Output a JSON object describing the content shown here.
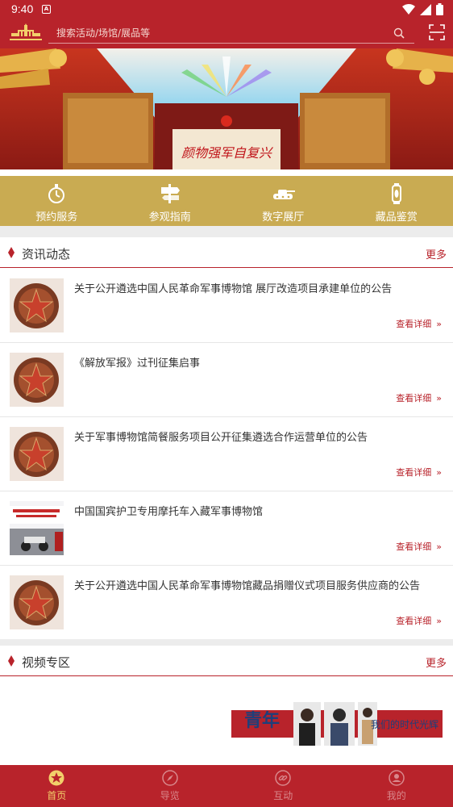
{
  "status_bar": {
    "time": "9:40",
    "notification": "A"
  },
  "header": {
    "search_placeholder": "搜索活动/场馆/展品等"
  },
  "banner": {
    "caption": "颜物强军自复兴"
  },
  "quick_nav": [
    {
      "label": "预约服务",
      "icon": "stopwatch-icon"
    },
    {
      "label": "参观指南",
      "icon": "signpost-icon"
    },
    {
      "label": "数字展厅",
      "icon": "tank-icon"
    },
    {
      "label": "藏品鉴赏",
      "icon": "lantern-icon"
    }
  ],
  "news_section": {
    "title": "资讯动态",
    "more": "更多"
  },
  "news": [
    {
      "title": "关于公开遴选中国人民革命军事博物馆 展厅改造项目承建单位的公告",
      "detail": "查看详细",
      "thumb": "emblem"
    },
    {
      "title": "《解放军报》过刊征集启事",
      "detail": "查看详细",
      "thumb": "emblem"
    },
    {
      "title": "关于军事博物馆简餐服务项目公开征集遴选合作运营单位的公告",
      "detail": "查看详细",
      "thumb": "emblem"
    },
    {
      "title": "中国国宾护卫专用摩托车入藏军事博物馆",
      "detail": "查看详细",
      "thumb": "photo"
    },
    {
      "title": "关于公开遴选中国人民革命军事博物馆藏品捐赠仪式项目服务供应商的公告",
      "detail": "查看详细",
      "thumb": "emblem"
    }
  ],
  "video_section": {
    "title": "视频专区",
    "more": "更多"
  },
  "video": {
    "left_text": "青年",
    "right_text": "我们的时代光辉"
  },
  "tabs": [
    {
      "label": "首页",
      "icon": "star-icon",
      "active": true
    },
    {
      "label": "导览",
      "icon": "compass-icon",
      "active": false
    },
    {
      "label": "互动",
      "icon": "link-icon",
      "active": false
    },
    {
      "label": "我的",
      "icon": "user-icon",
      "active": false
    }
  ],
  "colors": {
    "primary": "#b8232b",
    "gold": "#c9ab52",
    "tab_active": "#f2cf6a"
  }
}
